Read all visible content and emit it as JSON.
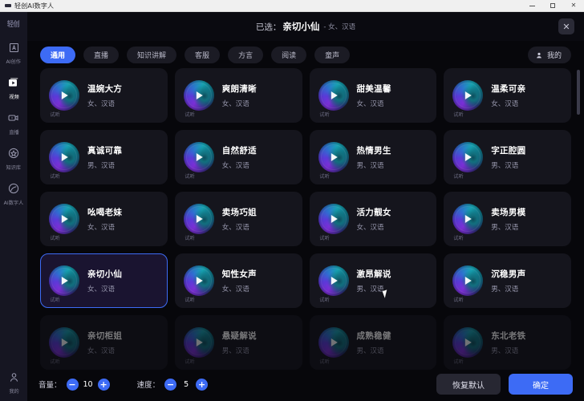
{
  "window": {
    "title": "轻创AI数字人",
    "minimize_icon": "minimize-icon",
    "maximize_icon": "maximize-icon",
    "close_icon": "close-icon"
  },
  "sidebar": {
    "logo_text": "轻创",
    "items": [
      {
        "label": "AI创作",
        "icon": "text-frame-icon",
        "active": false
      },
      {
        "label": "视频",
        "icon": "video-stack-icon",
        "active": true
      },
      {
        "label": "直播",
        "icon": "camera-icon",
        "active": false
      },
      {
        "label": "知识库",
        "icon": "star-badge-icon",
        "active": false
      },
      {
        "label": "AI数字人",
        "icon": "avatar-orb-icon",
        "active": false
      }
    ],
    "bottom_item": {
      "label": "我的",
      "icon": "user-icon"
    }
  },
  "dialog": {
    "selected_prefix": "已选：",
    "selected_name": "亲切小仙",
    "selected_meta": "- 女、汉语",
    "close_label": "✕"
  },
  "tabs": [
    {
      "label": "通用",
      "active": true
    },
    {
      "label": "直播",
      "active": false
    },
    {
      "label": "知识讲解",
      "active": false
    },
    {
      "label": "客服",
      "active": false
    },
    {
      "label": "方言",
      "active": false
    },
    {
      "label": "阅读",
      "active": false
    },
    {
      "label": "童声",
      "active": false
    }
  ],
  "mine_button": {
    "label": "我的",
    "icon": "user-icon"
  },
  "card_trial_label": "试听",
  "voices": [
    {
      "name": "温婉大方",
      "meta": "女、汉语",
      "selected": false,
      "faded": false
    },
    {
      "name": "爽朗清晰",
      "meta": "女、汉语",
      "selected": false,
      "faded": false
    },
    {
      "name": "甜美温馨",
      "meta": "女、汉语",
      "selected": false,
      "faded": false
    },
    {
      "name": "温柔可亲",
      "meta": "女、汉语",
      "selected": false,
      "faded": false
    },
    {
      "name": "真诚可靠",
      "meta": "男、汉语",
      "selected": false,
      "faded": false
    },
    {
      "name": "自然舒适",
      "meta": "女、汉语",
      "selected": false,
      "faded": false
    },
    {
      "name": "热情男生",
      "meta": "男、汉语",
      "selected": false,
      "faded": false
    },
    {
      "name": "字正腔圆",
      "meta": "男、汉语",
      "selected": false,
      "faded": false
    },
    {
      "name": "吆喝老妹",
      "meta": "女、汉语",
      "selected": false,
      "faded": false
    },
    {
      "name": "卖场巧姐",
      "meta": "女、汉语",
      "selected": false,
      "faded": false
    },
    {
      "name": "活力靓女",
      "meta": "女、汉语",
      "selected": false,
      "faded": false
    },
    {
      "name": "卖场男模",
      "meta": "男、汉语",
      "selected": false,
      "faded": false
    },
    {
      "name": "亲切小仙",
      "meta": "女、汉语",
      "selected": true,
      "faded": false
    },
    {
      "name": "知性女声",
      "meta": "女、汉语",
      "selected": false,
      "faded": false
    },
    {
      "name": "激昂解说",
      "meta": "男、汉语",
      "selected": false,
      "faded": false
    },
    {
      "name": "沉稳男声",
      "meta": "男、汉语",
      "selected": false,
      "faded": false
    },
    {
      "name": "亲切柜姐",
      "meta": "女、汉语",
      "selected": false,
      "faded": true
    },
    {
      "name": "悬疑解说",
      "meta": "男、汉语",
      "selected": false,
      "faded": true
    },
    {
      "name": "成熟稳健",
      "meta": "男、汉语",
      "selected": false,
      "faded": true
    },
    {
      "name": "东北老铁",
      "meta": "男、汉语",
      "selected": false,
      "faded": true
    }
  ],
  "controls": {
    "volume_label": "音量：",
    "volume_value": "10",
    "speed_label": "速度：",
    "speed_value": "5",
    "minus": "−",
    "plus": "+",
    "reset_label": "恢复默认",
    "confirm_label": "确定"
  },
  "colors": {
    "accent": "#3d6bf5",
    "panel": "#15151d",
    "background": "#07070b",
    "sidebar": "#161622"
  }
}
